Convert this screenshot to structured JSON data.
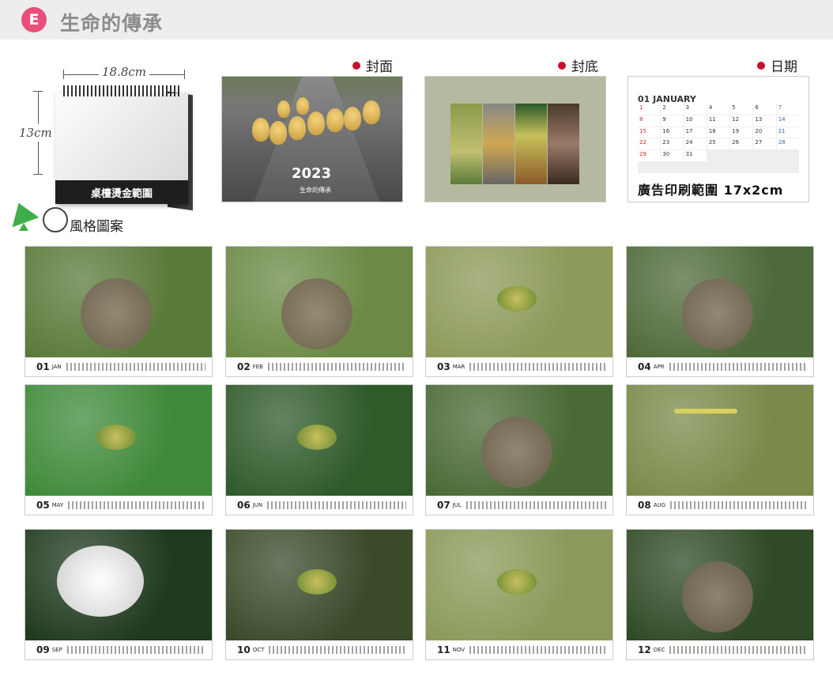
{
  "header": {
    "badge": "E",
    "title": "生命的傳承"
  },
  "desk": {
    "width_label": "18.8cm",
    "height_label": "13cm",
    "base_text": "桌檯燙金範圍"
  },
  "sections": {
    "cover": "封面",
    "back": "封底",
    "dates": "日期"
  },
  "cover": {
    "year": "2023",
    "subtitle": "生命的傳承"
  },
  "dates_panel": {
    "month_header": "01 JANUARY",
    "days": [
      "1",
      "2",
      "3",
      "4",
      "5",
      "6",
      "7",
      "8",
      "9",
      "10",
      "11",
      "12",
      "13",
      "14",
      "15",
      "16",
      "17",
      "18",
      "19",
      "20",
      "21",
      "22",
      "23",
      "24",
      "25",
      "26",
      "27",
      "28",
      "29",
      "30",
      "31"
    ],
    "ad_text": "廣告印刷範圍 17x2cm"
  },
  "style_label": "風格圖案",
  "months": [
    {
      "num": "01",
      "name": "JAN",
      "scene": "monkeys",
      "bg": "#5a7a3a"
    },
    {
      "num": "02",
      "name": "FEB",
      "scene": "monkeys",
      "bg": "#6b8a45"
    },
    {
      "num": "03",
      "name": "MAR",
      "scene": "bird-flower",
      "bg": "#8c9a5a"
    },
    {
      "num": "04",
      "name": "APR",
      "scene": "monkeys",
      "bg": "#4f6a3a"
    },
    {
      "num": "05",
      "name": "MAY",
      "scene": "barbets",
      "bg": "#3f8a3a"
    },
    {
      "num": "06",
      "name": "JUN",
      "scene": "white-eye-nest",
      "bg": "#2f5a2a"
    },
    {
      "num": "07",
      "name": "JUL",
      "scene": "monkeys-branch",
      "bg": "#4a6a35"
    },
    {
      "num": "08",
      "name": "AUG",
      "scene": "dragonfly",
      "bg": "#7a8a4a"
    },
    {
      "num": "09",
      "name": "SEP",
      "scene": "egrets",
      "bg": "#1f3a1f"
    },
    {
      "num": "10",
      "name": "OCT",
      "scene": "bird-nest",
      "bg": "#3a4a2a"
    },
    {
      "num": "11",
      "name": "NOV",
      "scene": "white-eyes",
      "bg": "#8a9a5a"
    },
    {
      "num": "12",
      "name": "DEC",
      "scene": "monkeys-tree",
      "bg": "#2f4a25"
    }
  ]
}
